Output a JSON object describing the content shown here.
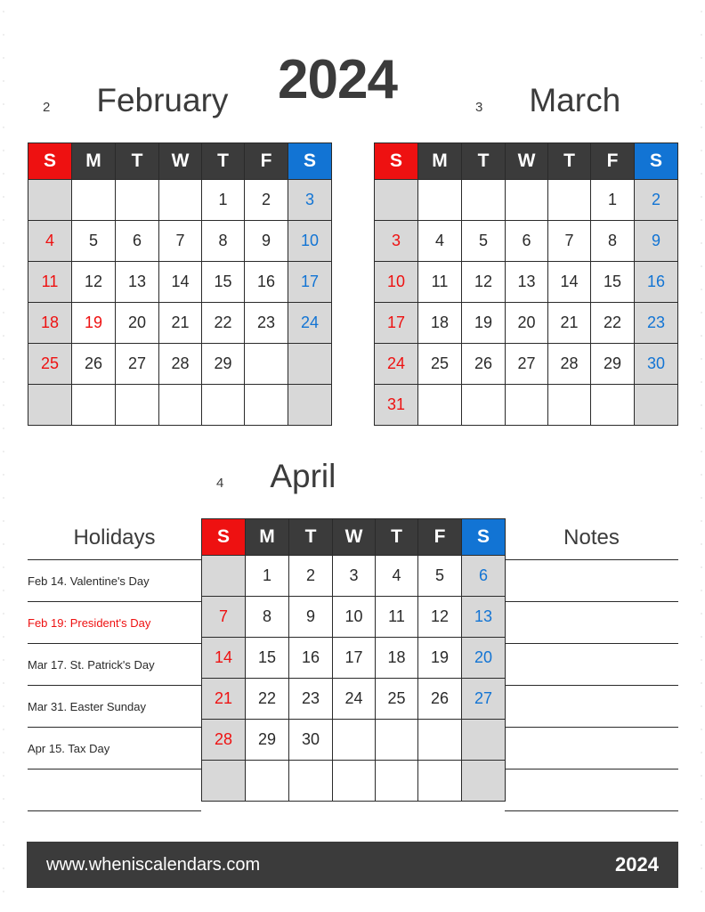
{
  "year": "2024",
  "footer": {
    "site": "www.wheniscalendars.com",
    "year": "2024"
  },
  "weekday_headers": [
    "S",
    "M",
    "T",
    "W",
    "T",
    "F",
    "S"
  ],
  "months": [
    {
      "number": "2",
      "name": "February",
      "weeks": [
        [
          "",
          "",
          "",
          "",
          "1",
          "2",
          "3"
        ],
        [
          "4",
          "5",
          "6",
          "7",
          "8",
          "9",
          "10"
        ],
        [
          "11",
          "12",
          "13",
          "14",
          "15",
          "16",
          "17"
        ],
        [
          "18",
          "19",
          "20",
          "21",
          "22",
          "23",
          "24"
        ],
        [
          "25",
          "26",
          "27",
          "28",
          "29",
          "",
          ""
        ],
        [
          "",
          "",
          "",
          "",
          "",
          "",
          ""
        ]
      ],
      "highlighted": [
        "19"
      ]
    },
    {
      "number": "3",
      "name": "March",
      "weeks": [
        [
          "",
          "",
          "",
          "",
          "",
          "1",
          "2"
        ],
        [
          "3",
          "4",
          "5",
          "6",
          "7",
          "8",
          "9"
        ],
        [
          "10",
          "11",
          "12",
          "13",
          "14",
          "15",
          "16"
        ],
        [
          "17",
          "18",
          "19",
          "20",
          "21",
          "22",
          "23"
        ],
        [
          "24",
          "25",
          "26",
          "27",
          "28",
          "29",
          "30"
        ],
        [
          "31",
          "",
          "",
          "",
          "",
          "",
          ""
        ]
      ],
      "highlighted": []
    },
    {
      "number": "4",
      "name": "April",
      "weeks": [
        [
          "",
          "1",
          "2",
          "3",
          "4",
          "5",
          "6"
        ],
        [
          "7",
          "8",
          "9",
          "10",
          "11",
          "12",
          "13"
        ],
        [
          "14",
          "15",
          "16",
          "17",
          "18",
          "19",
          "20"
        ],
        [
          "21",
          "22",
          "23",
          "24",
          "25",
          "26",
          "27"
        ],
        [
          "28",
          "29",
          "30",
          "",
          "",
          "",
          ""
        ],
        [
          "",
          "",
          "",
          "",
          "",
          "",
          ""
        ]
      ],
      "highlighted": []
    }
  ],
  "holidays": {
    "title": "Holidays",
    "items": [
      {
        "text": "Feb 14. Valentine's Day",
        "red": false
      },
      {
        "text": "Feb 19: President's Day",
        "red": true
      },
      {
        "text": "Mar 17. St. Patrick's Day",
        "red": false
      },
      {
        "text": "Mar 31. Easter Sunday",
        "red": false
      },
      {
        "text": "Apr 15. Tax Day",
        "red": false
      },
      {
        "text": "",
        "red": false
      }
    ]
  },
  "notes": {
    "title": "Notes",
    "rows": [
      "",
      "",
      "",
      "",
      "",
      ""
    ]
  },
  "colors": {
    "sunday": "#ee1111",
    "saturday": "#1274d4",
    "header_bg": "#3b3b3b",
    "weekend_cell_bg": "#d8d8d8"
  }
}
